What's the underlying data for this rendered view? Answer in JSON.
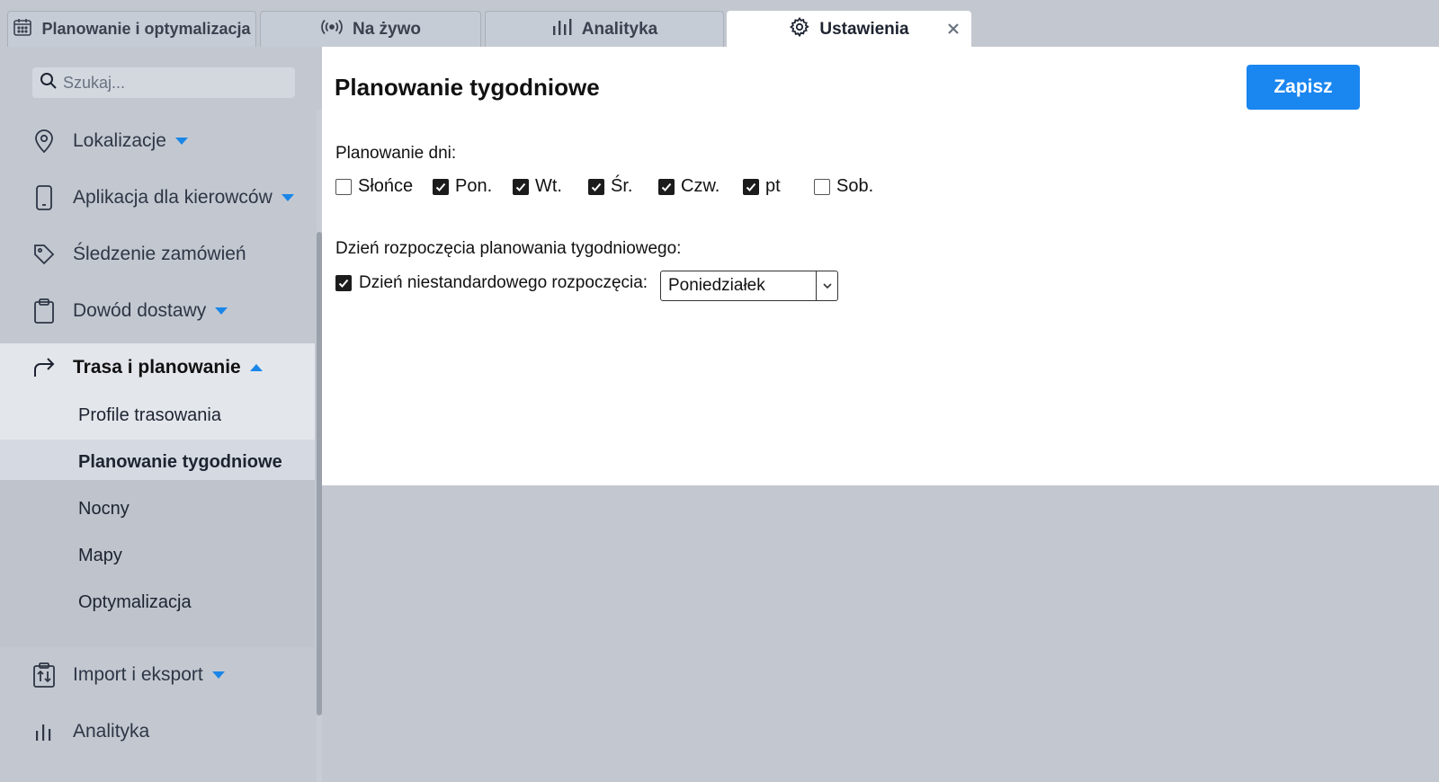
{
  "tabs": [
    {
      "label": "Planowanie i optymalizacja",
      "icon": "calendar-icon"
    },
    {
      "label": "Na żywo",
      "icon": "broadcast-icon"
    },
    {
      "label": "Analityka",
      "icon": "bar-chart-icon"
    },
    {
      "label": "Ustawienia",
      "icon": "gear-icon",
      "active": true
    }
  ],
  "sidebar": {
    "search_placeholder": "Szukaj...",
    "items": [
      {
        "label": "Lokalizacje",
        "icon": "location-pin-icon",
        "expandable": true
      },
      {
        "label": "Aplikacja dla kierowców",
        "icon": "phone-icon",
        "expandable": true
      },
      {
        "label": "Śledzenie zamówień",
        "icon": "tag-icon"
      },
      {
        "label": "Dowód dostawy",
        "icon": "clipboard-icon",
        "expandable": true
      },
      {
        "label": "Trasa i planowanie",
        "icon": "route-arrow-icon",
        "expanded": true
      },
      {
        "label": "Import i eksport",
        "icon": "import-export-icon",
        "expandable": true
      },
      {
        "label": "Analityka",
        "icon": "bar-chart-icon"
      }
    ],
    "sub_items": [
      {
        "label": "Profile trasowania"
      },
      {
        "label": "Planowanie tygodniowe",
        "selected": true
      },
      {
        "label": "Nocny"
      },
      {
        "label": "Mapy"
      },
      {
        "label": "Optymalizacja"
      }
    ]
  },
  "main": {
    "title": "Planowanie tygodniowe",
    "save_label": "Zapisz",
    "days_label": "Planowanie dni:",
    "days": [
      {
        "label": "Słońce",
        "checked": false
      },
      {
        "label": "Pon.",
        "checked": true
      },
      {
        "label": "Wt.",
        "checked": true
      },
      {
        "label": "Śr.",
        "checked": true
      },
      {
        "label": "Czw.",
        "checked": true
      },
      {
        "label": "pt",
        "checked": true
      },
      {
        "label": "Sob.",
        "checked": false
      }
    ],
    "start_day_label": "Dzień rozpoczęcia planowania tygodniowego:",
    "custom_start_label": "Dzień niestandardowego rozpoczęcia:",
    "custom_start_checked": true,
    "custom_start_value": "Poniedziałek"
  },
  "colors": {
    "accent": "#1a86f0",
    "background": "#c3c8d0",
    "panel": "#ffffff"
  }
}
